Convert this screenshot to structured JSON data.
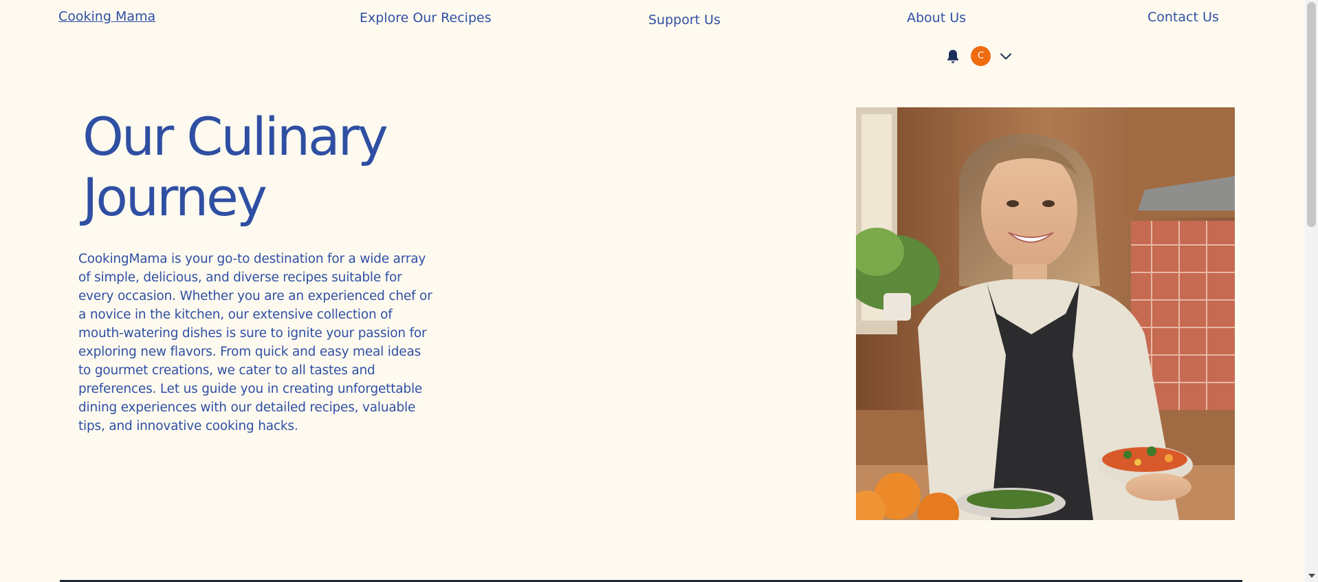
{
  "nav": {
    "brand": "Cooking Mama",
    "links": [
      "Explore Our Recipes",
      "Support Us",
      "About Us",
      "Contact Us"
    ]
  },
  "user": {
    "avatar_initial": "C",
    "notification_icon": "bell-icon",
    "menu_icon": "chevron-down-icon"
  },
  "hero": {
    "title_line1": "Our Culinary",
    "title_line2": "Journey",
    "body": "CookingMama is your go-to destination for a wide array of simple, delicious, and diverse recipes suitable for every occasion. Whether you are an experienced chef or a novice in the kitchen, our extensive collection of mouth-watering dishes is sure to ignite your passion for exploring new flavors. From quick and easy meal ideas to gourmet creations, we cater to all tastes and preferences. Let us guide you in creating unforgettable dining experiences with our detailed recipes, valuable tips, and innovative cooking hacks."
  },
  "colors": {
    "background": "#fefaf0",
    "text": "#2f4fa3",
    "avatar": "#ef6c10"
  }
}
